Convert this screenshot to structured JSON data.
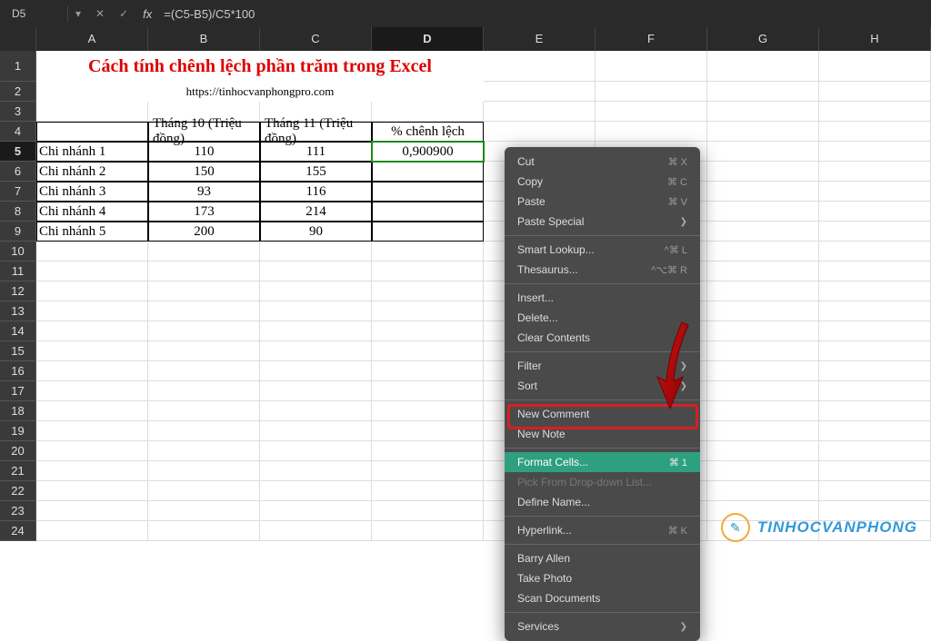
{
  "formula_bar": {
    "name_box": "D5",
    "fx": "fx",
    "formula": "=(C5-B5)/C5*100"
  },
  "columns": [
    "A",
    "B",
    "C",
    "D",
    "E",
    "F",
    "G",
    "H"
  ],
  "selected_col": "D",
  "selected_row": 5,
  "title": "Cách tính chênh lệch phần trăm trong Excel",
  "subtitle": "https://tinhocvanphongpro.com",
  "table": {
    "headers": [
      "",
      "Tháng 10 (Triệu đồng)",
      "Tháng 11 (Triệu đồng)",
      "% chênh lệch"
    ],
    "rows": [
      [
        "Chi nhánh 1",
        "110",
        "111",
        "0,900900"
      ],
      [
        "Chi nhánh 2",
        "150",
        "155",
        ""
      ],
      [
        "Chi nhánh 3",
        "93",
        "116",
        ""
      ],
      [
        "Chi nhánh 4",
        "173",
        "214",
        ""
      ],
      [
        "Chi nhánh 5",
        "200",
        "90",
        ""
      ]
    ]
  },
  "context_menu": [
    {
      "label": "Cut",
      "shortcut": "⌘ X",
      "type": "item"
    },
    {
      "label": "Copy",
      "shortcut": "⌘ C",
      "type": "item"
    },
    {
      "label": "Paste",
      "shortcut": "⌘ V",
      "type": "item"
    },
    {
      "label": "Paste Special",
      "sub": true,
      "type": "item"
    },
    {
      "type": "sep"
    },
    {
      "label": "Smart Lookup...",
      "shortcut": "^⌘ L",
      "type": "item"
    },
    {
      "label": "Thesaurus...",
      "shortcut": "^⌥⌘ R",
      "type": "item"
    },
    {
      "type": "sep"
    },
    {
      "label": "Insert...",
      "type": "item"
    },
    {
      "label": "Delete...",
      "type": "item"
    },
    {
      "label": "Clear Contents",
      "type": "item"
    },
    {
      "type": "sep"
    },
    {
      "label": "Filter",
      "sub": true,
      "type": "item"
    },
    {
      "label": "Sort",
      "sub": true,
      "type": "item"
    },
    {
      "type": "sep"
    },
    {
      "label": "New Comment",
      "type": "item"
    },
    {
      "label": "New Note",
      "type": "item"
    },
    {
      "type": "sep"
    },
    {
      "label": "Format Cells...",
      "shortcut": "⌘ 1",
      "type": "item",
      "highlighted": true
    },
    {
      "label": "Pick From Drop-down List...",
      "type": "item",
      "obscured": true
    },
    {
      "label": "Define Name...",
      "type": "item"
    },
    {
      "type": "sep"
    },
    {
      "label": "Hyperlink...",
      "shortcut": "⌘ K",
      "type": "item"
    },
    {
      "type": "sep"
    },
    {
      "label": "Barry Allen",
      "type": "item"
    },
    {
      "label": "Take Photo",
      "type": "item"
    },
    {
      "label": "Scan Documents",
      "type": "item"
    },
    {
      "type": "sep"
    },
    {
      "label": "Services",
      "sub": true,
      "type": "item"
    }
  ],
  "watermark": {
    "icon_glyph": "✎",
    "text": "TINHOCVANPHONG"
  }
}
